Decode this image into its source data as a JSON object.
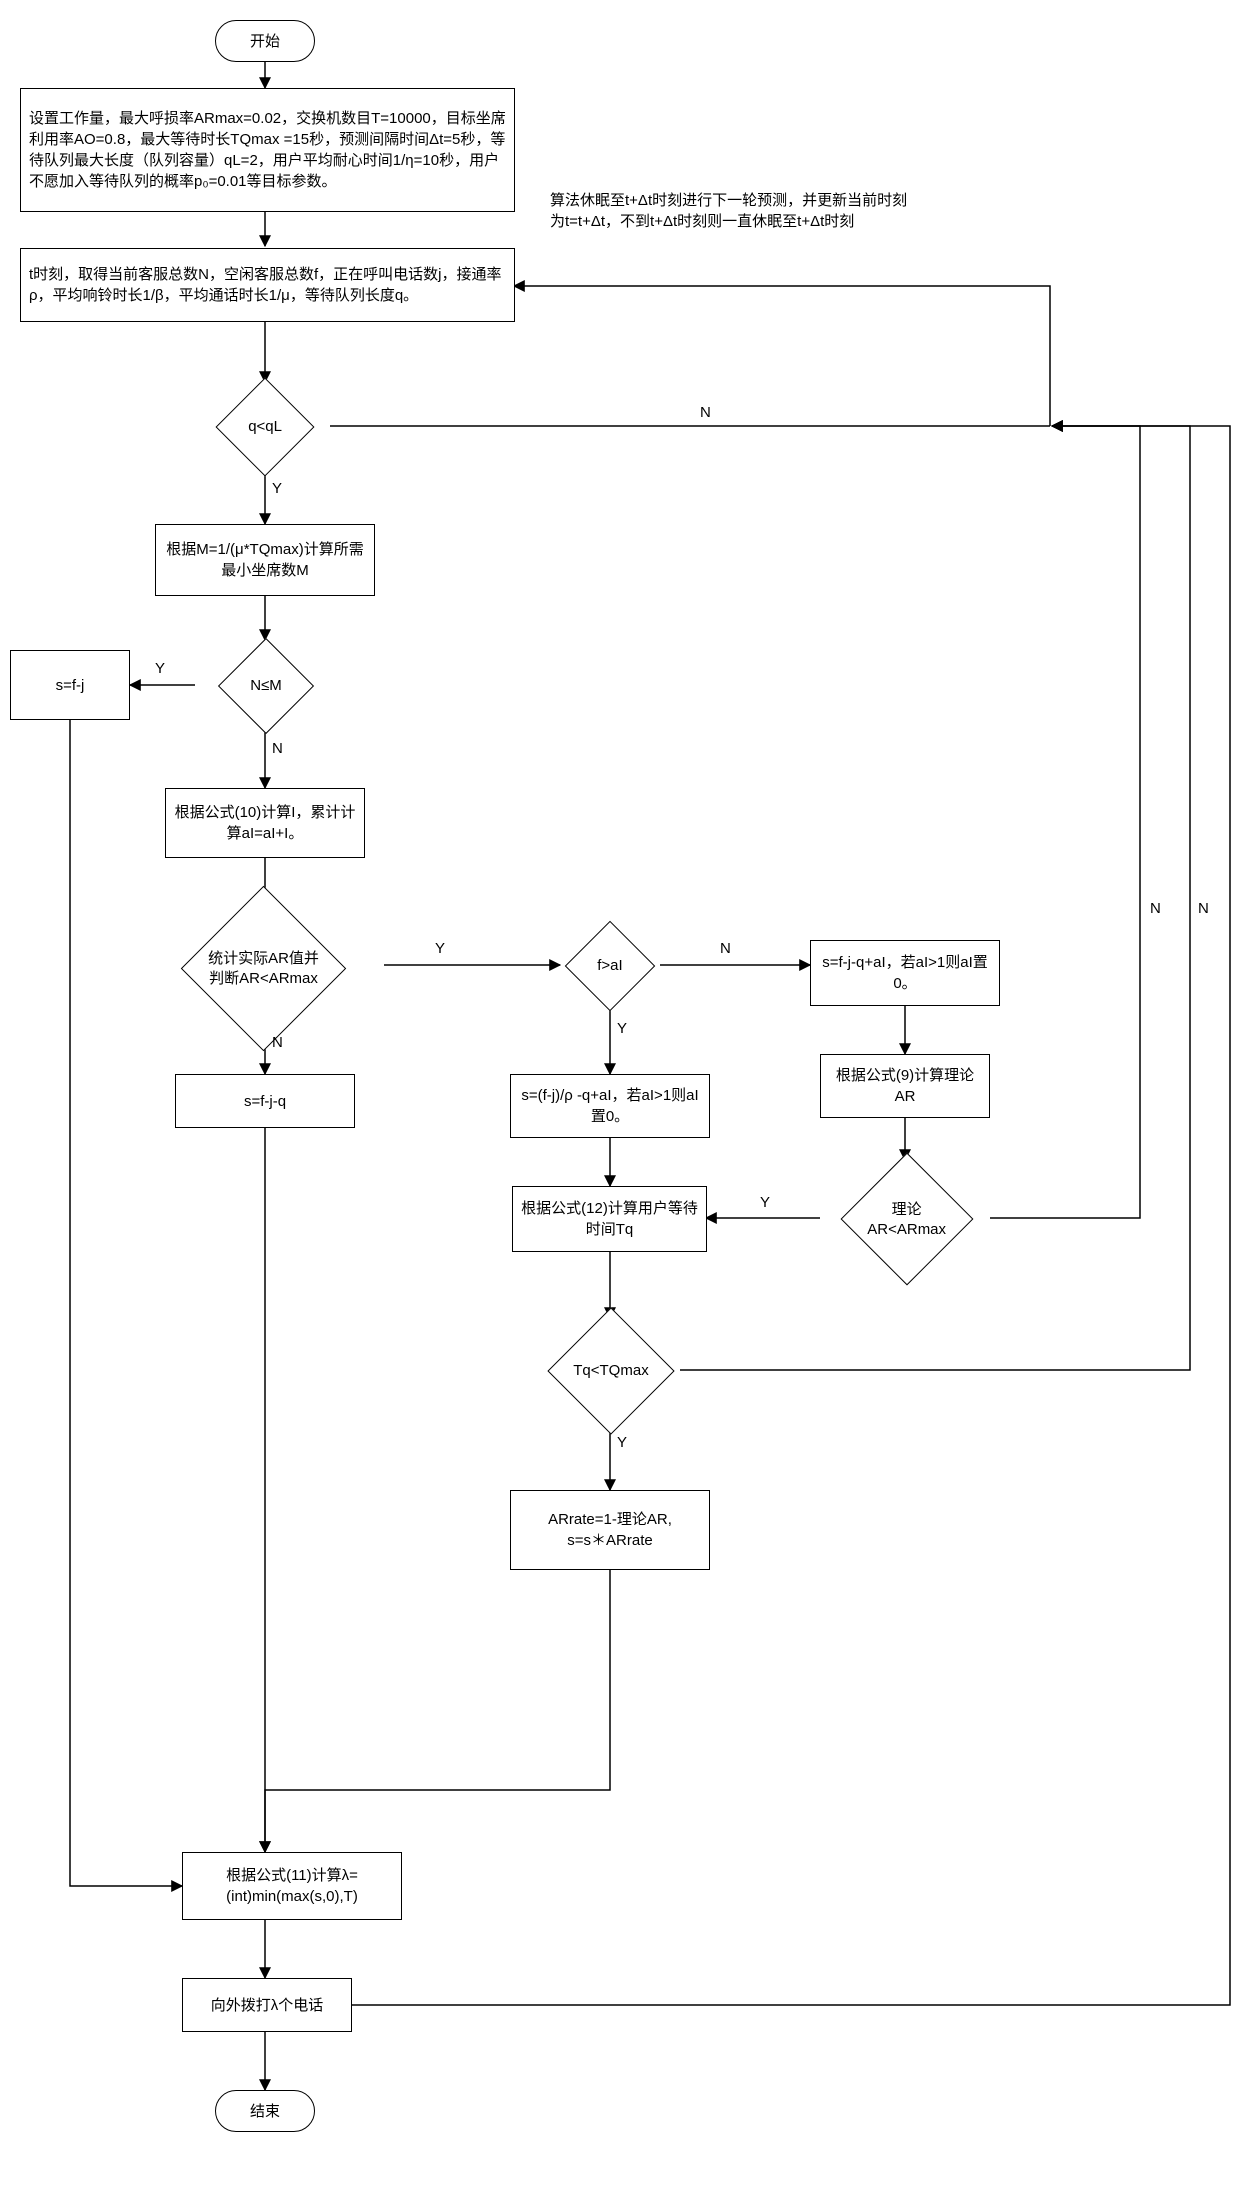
{
  "flow": {
    "start": "开始",
    "end": "结束",
    "init_params": "设置工作量，最大呼损率ARmax=0.02，交换机数目T=10000，目标坐席利用率AO=0.8，最大等待时长TQmax =15秒，预测间隔时间Δt=5秒，等待队列最大长度（队列容量）qL=2，用户平均耐心时间1/η=10秒，用户不愿加入等待队列的概率p₀=0.01等目标参数。",
    "sample_state": "t时刻，取得当前客服总数N，空闲客服总数f，正在呼叫电话数j，接通率ρ，平均响铃时长1/β，平均通话时长1/μ，等待队列长度q。",
    "sleep_note": "算法休眠至t+Δt时刻进行下一轮预测，并更新当前时刻为t=t+Δt，不到t+Δt时刻则一直休眠至t+Δt时刻",
    "d_q_lt_qL": "q<qL",
    "calc_M": "根据M=1/(μ*TQmax)计算所需最小坐席数M",
    "d_N_le_M": "N≤M",
    "s_eq_fj": "s=f-j",
    "calc_I": "根据公式(10)计算I，累计计算aI=aI+I。",
    "d_AR_lt_ARmax": "统计实际AR值并判断AR<ARmax",
    "s_eq_fjq": "s=f-j-q",
    "d_f_gt_aI": "f>aI",
    "s_branch_a": "s=(f-j)/ρ -q+aI，若aI>1则aI置0。",
    "s_branch_b": "s=f-j-q+aI，若aI>1则aI置0。",
    "calc_theo_AR": "根据公式(9)计算理论AR",
    "d_theoAR": "理论AR<ARmax",
    "calc_Tq": "根据公式(12)计算用户等待时间Tq",
    "d_Tq": "Tq<TQmax",
    "apply_rate": "ARrate=1-理论AR,\ns=s＊ARrate",
    "calc_lambda": "根据公式(11)计算λ=(int)min(max(s,0),T)",
    "dial": "向外拨打λ个电话"
  },
  "labels": {
    "Y": "Y",
    "N": "N"
  }
}
